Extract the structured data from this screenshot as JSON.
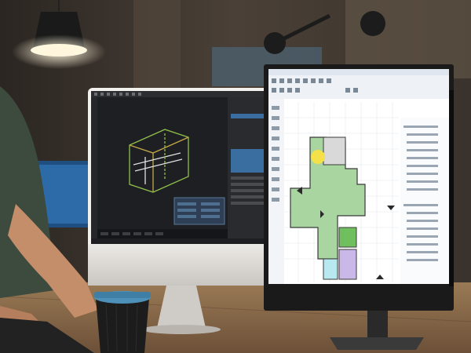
{
  "scene": {
    "description_tags": [
      "office",
      "dual-monitor",
      "3d-modeling",
      "floor-plan-cad"
    ],
    "palette": {
      "wall": "#3a342d",
      "wall_light": "#5a5046",
      "desk": "#8a6a48",
      "left_screen_bg": "#1e1f22",
      "right_screen_bg": "#ffffff",
      "plan_green": "#a8d5a0",
      "lamp_glow": "#f5e9c9",
      "cup": "#1c1c1c",
      "cup_lid": "#4d90b8"
    }
  },
  "left_monitor": {
    "app": "3d-editor",
    "panel_labels": []
  },
  "right_monitor": {
    "app": "cad-floor-plan",
    "panel_labels": []
  }
}
